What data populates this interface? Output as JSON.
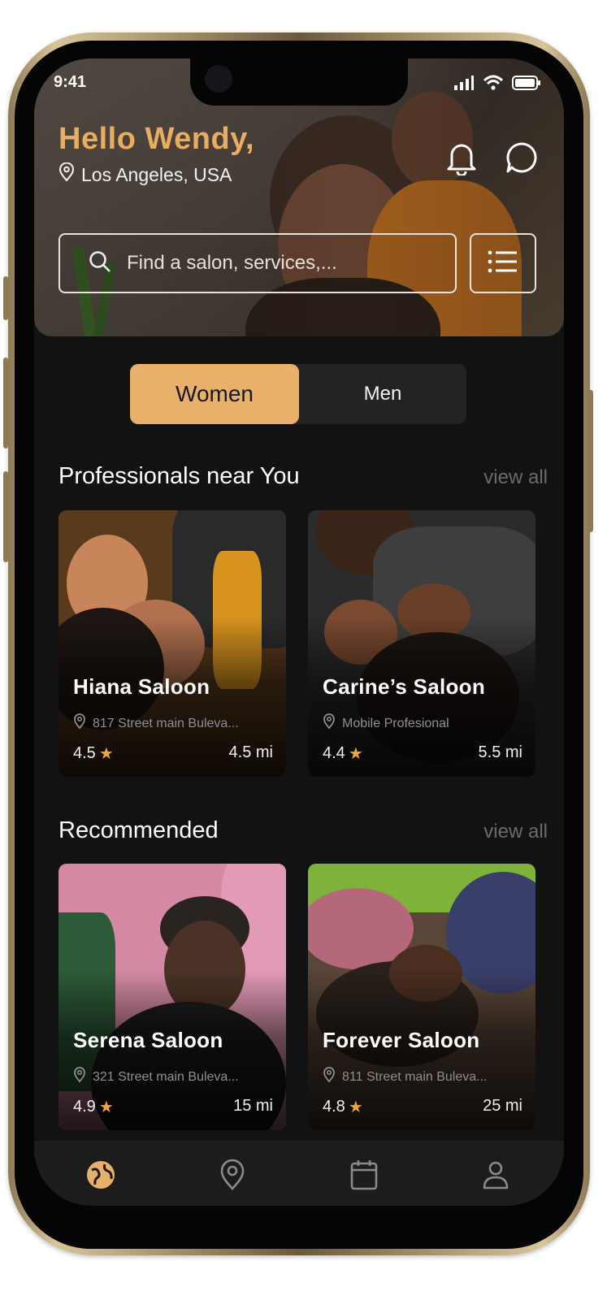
{
  "status_bar": {
    "time": "9:41"
  },
  "header": {
    "greeting": "Hello Wendy,",
    "location": "Los Angeles, USA",
    "icons": [
      "bell-icon",
      "chat-bubble-icon"
    ]
  },
  "search": {
    "placeholder": "Find a salon, services,..."
  },
  "filter_icon": "list-filter-icon",
  "gender_toggle": {
    "options": [
      "Women",
      "Men"
    ],
    "selected": "Women"
  },
  "sections": {
    "professionals": {
      "title": "Professionals near You",
      "view_all": "view all",
      "cards": [
        {
          "name": "Hiana Saloon",
          "address": "817 Street main Buleva...",
          "rating": "4.5",
          "distance": "4.5 mi"
        },
        {
          "name": "Carine’s Saloon",
          "address": "Mobile Profesional",
          "rating": "4.4",
          "distance": "5.5 mi"
        }
      ]
    },
    "recommended": {
      "title": "Recommended",
      "view_all": "view all",
      "cards": [
        {
          "name": "Serena Saloon",
          "address": "321 Street main Buleva...",
          "rating": "4.9",
          "distance": "15 mi"
        },
        {
          "name": "Forever Saloon",
          "address": "811 Street main Buleva...",
          "rating": "4.8",
          "distance": "25 mi"
        }
      ]
    }
  },
  "bottom_nav": {
    "items": [
      "home-globe-icon",
      "map-pin-icon",
      "calendar-icon",
      "profile-icon"
    ],
    "active": "home-globe-icon"
  },
  "colors": {
    "accent": "#e8b06b",
    "greeting": "#e8ad60",
    "background": "#121212",
    "star": "#f2a33a",
    "muted_text": "#6b6b6b"
  }
}
